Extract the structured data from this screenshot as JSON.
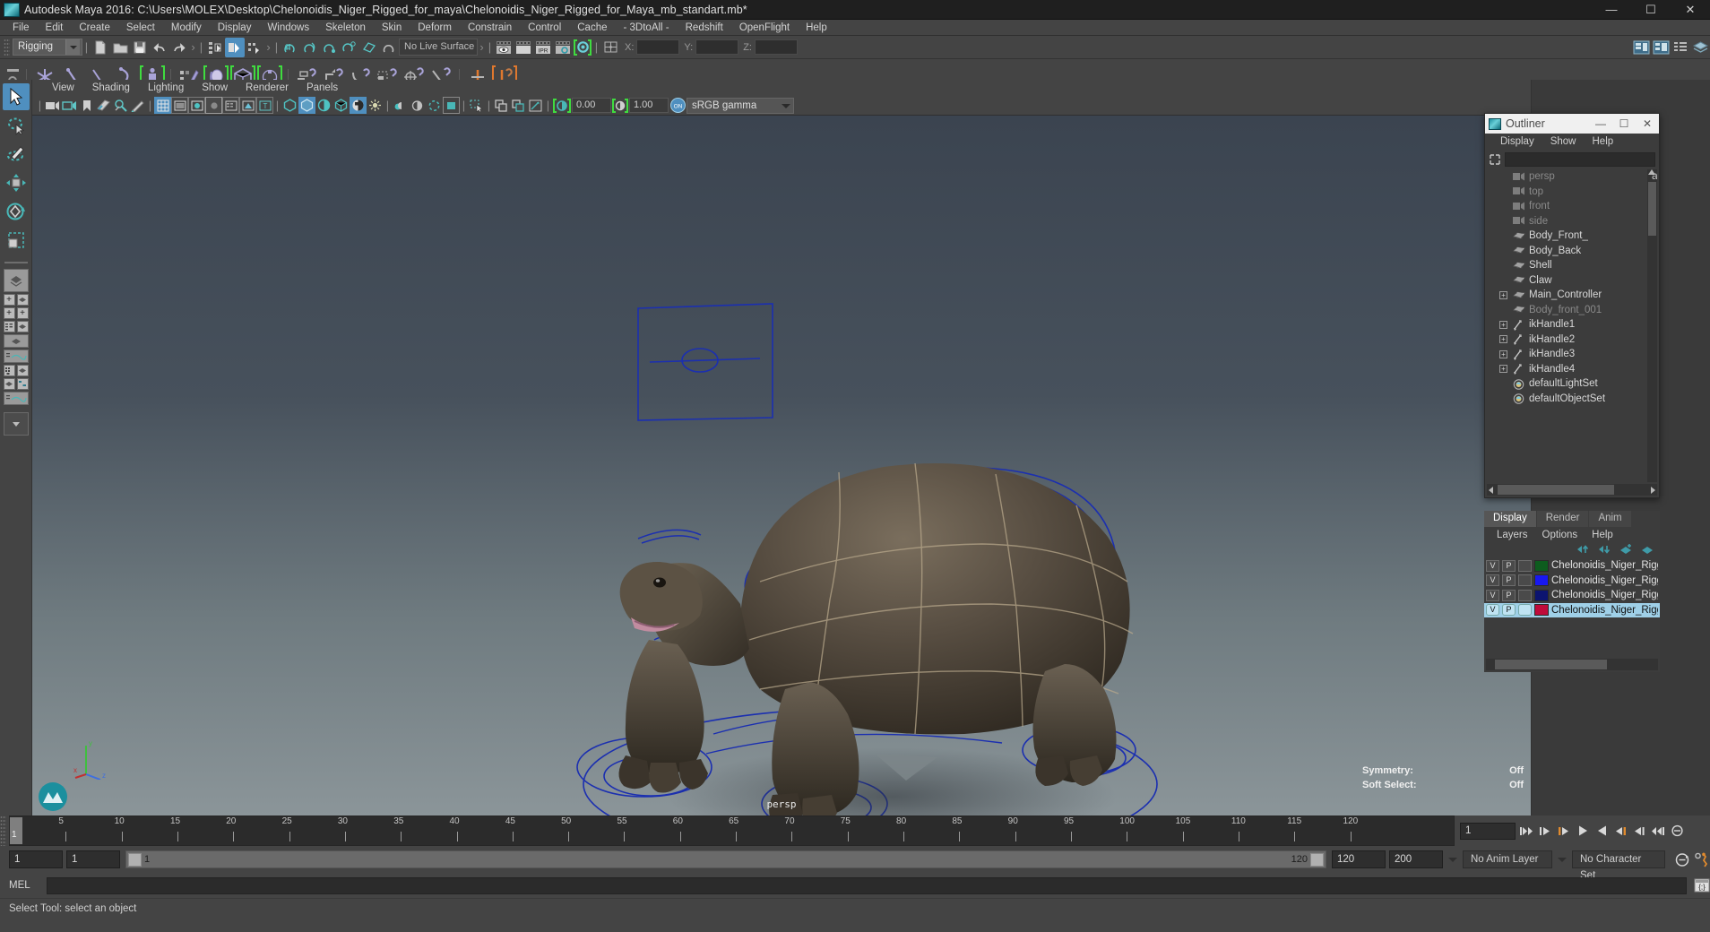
{
  "window": {
    "title": "Autodesk Maya 2016: C:\\Users\\MOLEX\\Desktop\\Chelonoidis_Niger_Rigged_for_maya\\Chelonoidis_Niger_Rigged_for_Maya_mb_standart.mb*",
    "minimize": "—",
    "maximize": "☐",
    "close": "✕"
  },
  "menubar": {
    "items": [
      "File",
      "Edit",
      "Create",
      "Select",
      "Modify",
      "Display",
      "Windows",
      "Skeleton",
      "Skin",
      "Deform",
      "Constrain",
      "Control",
      "Cache",
      "- 3DtoAll -",
      "Redshift",
      "OpenFlight",
      "Help"
    ]
  },
  "statusline": {
    "menu_set": "Rigging",
    "live_surface": "No Live Surface",
    "axis_x_label": "X:",
    "axis_y_label": "Y:",
    "axis_z_label": "Z:",
    "axis_x_value": "",
    "axis_y_value": "",
    "axis_z_value": "",
    "ipr_label": "IPR"
  },
  "panel_menu": {
    "items": [
      "View",
      "Shading",
      "Lighting",
      "Show",
      "Renderer",
      "Panels"
    ]
  },
  "viewport_toolbar": {
    "exposure_value": "0.00",
    "gamma_value": "1.00",
    "color_space": "sRGB gamma",
    "toggle_on_label": "ON"
  },
  "viewport": {
    "camera_label": "persp",
    "symmetry_label": "Symmetry:",
    "symmetry_value": "Off",
    "soft_select_label": "Soft Select:",
    "soft_select_value": "Off",
    "axis_x": "x",
    "axis_y": "y",
    "axis_z": "z",
    "curve_color": "#1b2fb0"
  },
  "outliner": {
    "title": "Outliner",
    "minimize": "—",
    "maximize": "☐",
    "close": "✕",
    "menu": [
      "Display",
      "Show",
      "Help"
    ],
    "search_value": "",
    "items": [
      {
        "label": "persp",
        "icon": "camera-icon",
        "dim": true,
        "expandable": false
      },
      {
        "label": "top",
        "icon": "camera-icon",
        "dim": true,
        "expandable": false
      },
      {
        "label": "front",
        "icon": "camera-icon",
        "dim": true,
        "expandable": false
      },
      {
        "label": "side",
        "icon": "camera-icon",
        "dim": true,
        "expandable": false
      },
      {
        "label": "Body_Front_",
        "icon": "mesh-icon",
        "dim": false,
        "expandable": false
      },
      {
        "label": "Body_Back",
        "icon": "mesh-icon",
        "dim": false,
        "expandable": false
      },
      {
        "label": "Shell",
        "icon": "mesh-icon",
        "dim": false,
        "expandable": false
      },
      {
        "label": "Claw",
        "icon": "mesh-icon",
        "dim": false,
        "expandable": false
      },
      {
        "label": "Main_Controller",
        "icon": "mesh-icon",
        "dim": false,
        "expandable": true
      },
      {
        "label": "Body_front_001",
        "icon": "mesh-icon",
        "dim": true,
        "expandable": false
      },
      {
        "label": "ikHandle1",
        "icon": "ikhandle-icon",
        "dim": false,
        "expandable": true
      },
      {
        "label": "ikHandle2",
        "icon": "ikhandle-icon",
        "dim": false,
        "expandable": true
      },
      {
        "label": "ikHandle3",
        "icon": "ikhandle-icon",
        "dim": false,
        "expandable": true
      },
      {
        "label": "ikHandle4",
        "icon": "ikhandle-icon",
        "dim": false,
        "expandable": true
      },
      {
        "label": "defaultLightSet",
        "icon": "set-icon",
        "dim": false,
        "expandable": false
      },
      {
        "label": "defaultObjectSet",
        "icon": "set-icon",
        "dim": false,
        "expandable": false
      }
    ]
  },
  "layer_editor": {
    "tabs": [
      "Display",
      "Render",
      "Anim"
    ],
    "active_tab": "Display",
    "menu": [
      "Layers",
      "Options",
      "Help"
    ],
    "visibility_label": "V",
    "playback_label": "P",
    "layers": [
      {
        "name": "Chelonoidis_Niger_Rigged_I",
        "color": "#0d5c1e",
        "selected": false
      },
      {
        "name": "Chelonoidis_Niger_Rigged_I",
        "color": "#1818f0",
        "selected": false
      },
      {
        "name": "Chelonoidis_Niger_Rigged_I",
        "color": "#0c1470",
        "selected": false
      },
      {
        "name": "Chelonoidis_Niger_Rigged_",
        "color": "#bf0b3a",
        "selected": true
      }
    ]
  },
  "time_slider": {
    "ticks": [
      5,
      10,
      15,
      20,
      25,
      30,
      35,
      40,
      45,
      50,
      55,
      60,
      65,
      70,
      75,
      80,
      85,
      90,
      95,
      100,
      105,
      110,
      115,
      120
    ],
    "current_frame": "1",
    "current_frame_field": "1",
    "playback_buttons": [
      "go-to-start",
      "step-back-key",
      "step-back-frame",
      "play-backwards",
      "play-forwards",
      "step-forward-frame",
      "step-forward-key",
      "go-to-end"
    ]
  },
  "range_slider": {
    "start_field": "1",
    "playback_start_field": "1",
    "range_start_label": "1",
    "range_end_label": "120",
    "playback_end_field": "120",
    "end_field": "200",
    "anim_layer": "No Anim Layer",
    "character_set": "No Character Set"
  },
  "command_line": {
    "label": "MEL",
    "value": "",
    "script_editor_icon": "script-editor-icon"
  },
  "status_bar": {
    "help_text": "Select Tool: select an object"
  },
  "left_toolbox": {
    "tools": [
      "select-tool",
      "lasso-select-tool",
      "paint-select-tool",
      "move-tool",
      "rotate-tool",
      "scale-tool"
    ],
    "layout_presets": [
      "single-perspective-view",
      "four-view",
      "persp-outliner",
      "persp-graph",
      "persp-hypershade",
      "hypergraph-persp",
      "persp-outliner-2",
      "persp-graph-editor",
      "more-layouts"
    ]
  }
}
